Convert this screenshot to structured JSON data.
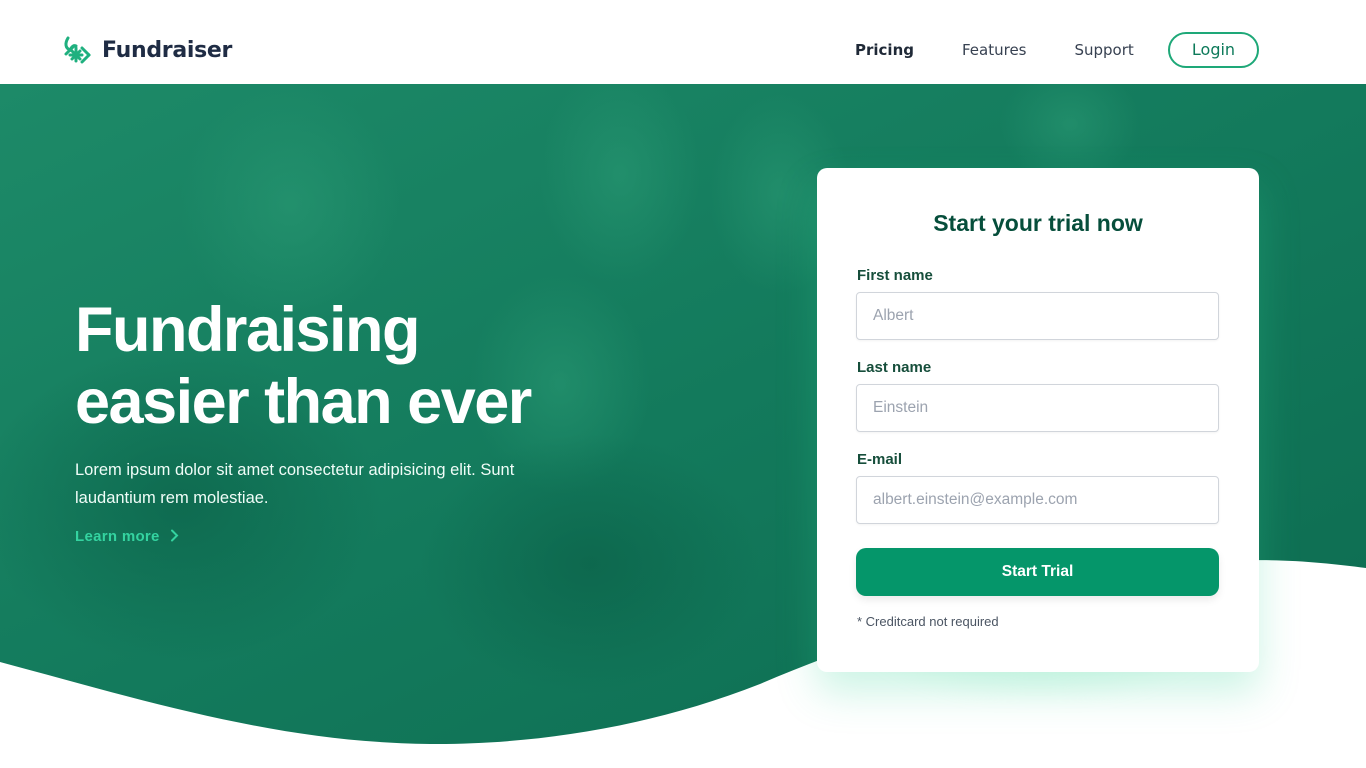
{
  "header": {
    "logo_text": "Fundraiser",
    "logo_icon": "leaf-snowflake-logo-icon",
    "nav": [
      {
        "label": "Pricing",
        "active": true
      },
      {
        "label": "Features",
        "active": false
      },
      {
        "label": "Support",
        "active": false
      }
    ],
    "login_label": "Login"
  },
  "hero": {
    "title_line1": "Fundraising",
    "title_line2": "easier than ever",
    "description": "Lorem ipsum dolor sit amet consectetur adipisicing elit. Sunt laudantium rem molestiae.",
    "learn_more": "Learn more",
    "learn_more_icon": "chevron-right-icon"
  },
  "form": {
    "title": "Start your trial now",
    "fields": [
      {
        "label": "First name",
        "placeholder": "Albert",
        "value": ""
      },
      {
        "label": "Last name",
        "placeholder": "Einstein",
        "value": ""
      },
      {
        "label": "E-mail",
        "placeholder": "albert.einstein@example.com",
        "value": ""
      }
    ],
    "submit_label": "Start Trial",
    "note": "* Creditcard not required"
  },
  "colors": {
    "brand_green": "#05966a",
    "hero_green": "#0f7a5c",
    "accent_light": "#34d3a0",
    "dark_text": "#064e3b"
  }
}
